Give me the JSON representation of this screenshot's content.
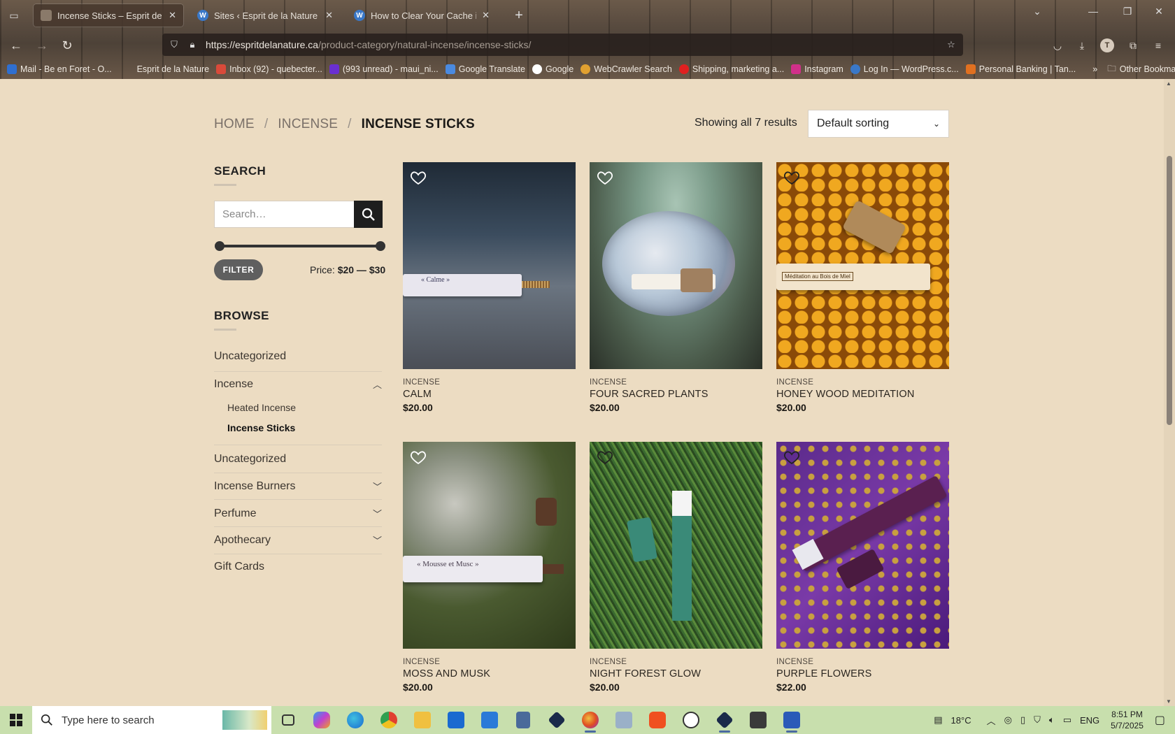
{
  "browser": {
    "tabs": [
      {
        "title": "Incense Sticks – Esprit de la Nat",
        "active": true
      },
      {
        "title": "Sites ‹ Esprit de la Nature — Wo",
        "active": false
      },
      {
        "title": "How to Clear Your Cache in Wo",
        "active": false
      }
    ],
    "url_host": "https://espritdelanature.ca",
    "url_path": "/product-category/natural-incense/incense-sticks/",
    "bookmarks": [
      "Mail - Be en Foret - O...",
      "Esprit de la Nature",
      "Inbox (92) - quebecter...",
      "(993 unread) - maui_ni...",
      "Google Translate",
      "Google",
      "WebCrawler Search",
      "Shipping, marketing a...",
      "Instagram",
      "Log In — WordPress.c...",
      "Personal Banking | Tan..."
    ],
    "other_bookmarks": "Other Bookmarks",
    "profile_initial": "T"
  },
  "page": {
    "breadcrumb": {
      "home": "HOME",
      "sep1": "/",
      "incense": "INCENSE",
      "sep2": "/",
      "current": "INCENSE STICKS"
    },
    "results_text": "Showing all 7 results",
    "sort_value": "Default sorting",
    "sidebar": {
      "search_title": "SEARCH",
      "search_placeholder": "Search…",
      "filter_label": "FILTER",
      "price_prefix": "Price:",
      "price_range": "$20 — $30",
      "browse_title": "BROWSE",
      "categories": [
        {
          "label": "Uncategorized"
        },
        {
          "label": "Incense",
          "expanded": true
        },
        {
          "label": "Heated Incense",
          "sub": true
        },
        {
          "label": "Incense Sticks",
          "sub": true,
          "active": true
        },
        {
          "label": "Uncategorized"
        },
        {
          "label": "Incense Burners"
        },
        {
          "label": "Perfume"
        },
        {
          "label": "Apothecary"
        },
        {
          "label": "Gift Cards"
        }
      ]
    },
    "products": [
      {
        "category": "INCENSE",
        "name": "CALM",
        "price": "$20.00",
        "label_text": "« Calme »"
      },
      {
        "category": "INCENSE",
        "name": "FOUR SACRED PLANTS",
        "price": "$20.00"
      },
      {
        "category": "INCENSE",
        "name": "HONEY WOOD MEDITATION",
        "price": "$20.00",
        "label_text": "Méditation au Bois de Miel"
      },
      {
        "category": "INCENSE",
        "name": "MOSS AND MUSK",
        "price": "$20.00",
        "label_text": "« Mousse et Musc »"
      },
      {
        "category": "INCENSE",
        "name": "NIGHT FOREST GLOW",
        "price": "$20.00"
      },
      {
        "category": "INCENSE",
        "name": "PURPLE FLOWERS",
        "price": "$22.00"
      }
    ]
  },
  "taskbar": {
    "search_placeholder": "Type here to search",
    "weather": "18°C",
    "language": "ENG",
    "time": "8:51 PM",
    "date": "5/7/2025"
  },
  "colors": {
    "page_bg": "#ecdcc2",
    "taskbar_bg": "#c8dfad",
    "search_button": "#1e1e1e",
    "filter_button": "#5f5f5f"
  }
}
